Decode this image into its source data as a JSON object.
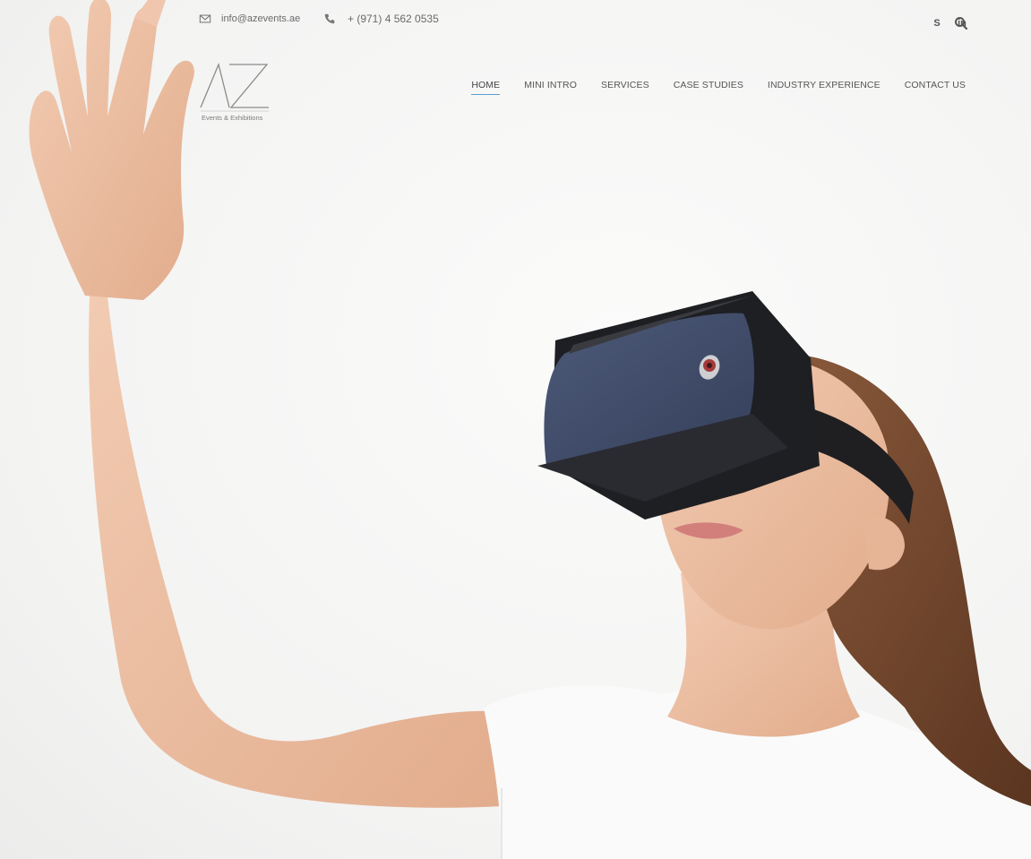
{
  "topbar": {
    "email": "info@azevents.ae",
    "phone": "+ (971) 4 562 0535",
    "social": [
      {
        "icon": "skype-icon",
        "glyph": "S"
      },
      {
        "icon": "linkedin-icon",
        "glyph": "in"
      }
    ],
    "search_icon": "search-icon"
  },
  "logo": {
    "mark": "AZ",
    "tagline": "Events & Exhibitions"
  },
  "nav": {
    "items": [
      {
        "label": "HOME",
        "active": true
      },
      {
        "label": "MINI INTRO",
        "active": false
      },
      {
        "label": "SERVICES",
        "active": false
      },
      {
        "label": "CASE STUDIES",
        "active": false
      },
      {
        "label": "INDUSTRY EXPERIENCE",
        "active": false
      },
      {
        "label": "CONTACT US",
        "active": false
      }
    ]
  },
  "colors": {
    "accent": "#5a9fd4",
    "text": "#555555",
    "headset": "#3d4a66"
  }
}
